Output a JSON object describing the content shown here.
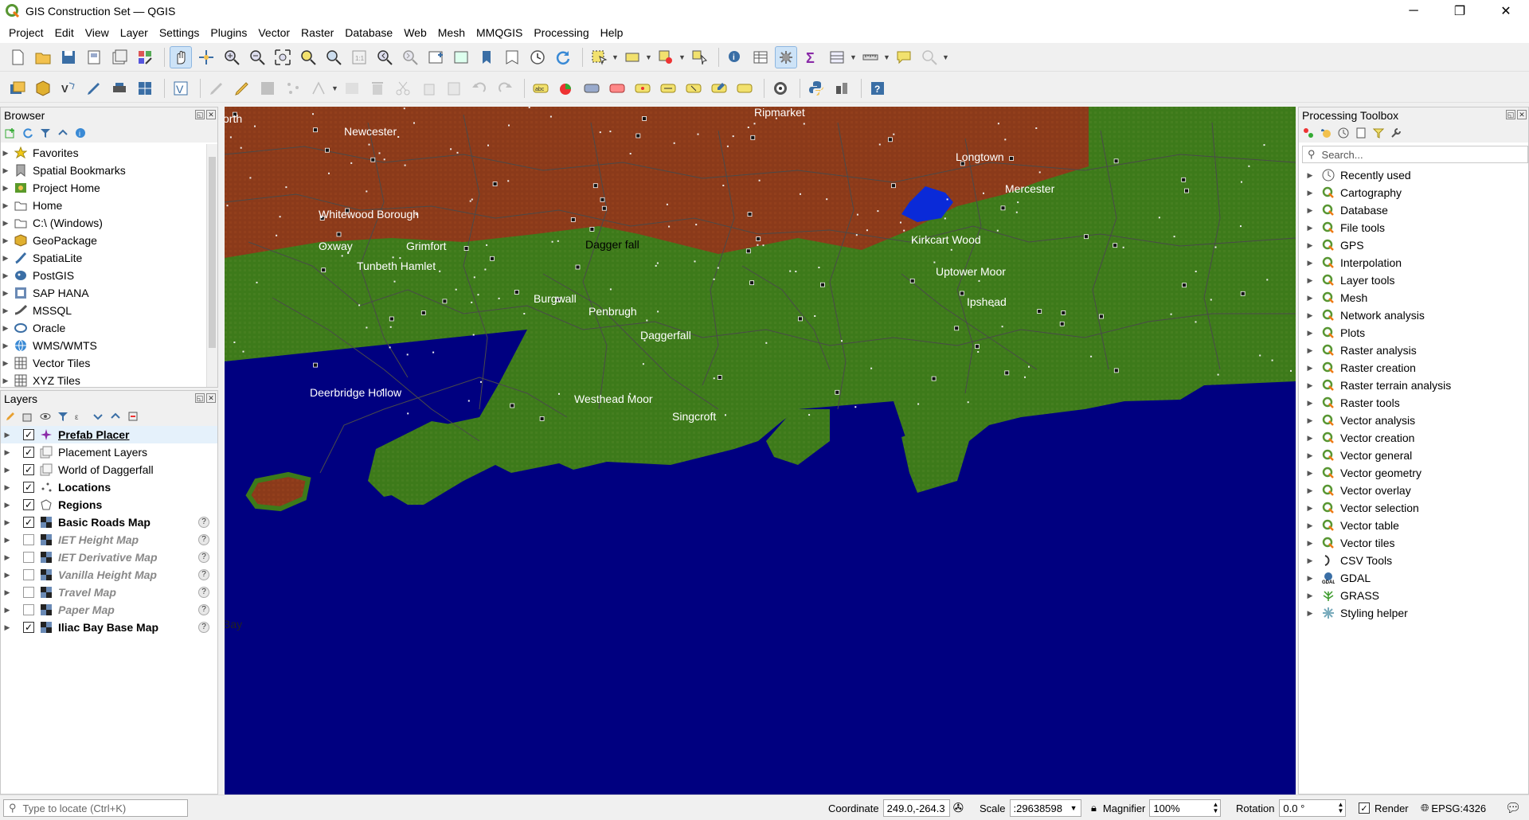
{
  "window": {
    "title": "GIS Construction Set — QGIS",
    "minimize": "─",
    "maximize": "❐",
    "close": "✕"
  },
  "menu": [
    "Project",
    "Edit",
    "View",
    "Layer",
    "Settings",
    "Plugins",
    "Vector",
    "Raster",
    "Database",
    "Web",
    "Mesh",
    "MMQGIS",
    "Processing",
    "Help"
  ],
  "browser": {
    "title": "Browser",
    "items": [
      {
        "label": "Favorites",
        "icon": "star-icon"
      },
      {
        "label": "Spatial Bookmarks",
        "icon": "bookmark-icon"
      },
      {
        "label": "Project Home",
        "icon": "project-home-icon"
      },
      {
        "label": "Home",
        "icon": "folder-icon"
      },
      {
        "label": "C:\\ (Windows)",
        "icon": "drive-icon"
      },
      {
        "label": "GeoPackage",
        "icon": "geopackage-icon"
      },
      {
        "label": "SpatiaLite",
        "icon": "spatialite-icon"
      },
      {
        "label": "PostGIS",
        "icon": "postgis-icon"
      },
      {
        "label": "SAP HANA",
        "icon": "sap-hana-icon"
      },
      {
        "label": "MSSQL",
        "icon": "mssql-icon"
      },
      {
        "label": "Oracle",
        "icon": "oracle-icon"
      },
      {
        "label": "WMS/WMTS",
        "icon": "globe-icon"
      },
      {
        "label": "Vector Tiles",
        "icon": "grid-icon"
      },
      {
        "label": "XYZ Tiles",
        "icon": "grid-icon"
      }
    ]
  },
  "layers": {
    "title": "Layers",
    "items": [
      {
        "label": "Prefab Placer",
        "checked": true,
        "style": "bold under",
        "icon": "star-sparkle-icon",
        "unknown": false
      },
      {
        "label": "Placement Layers",
        "checked": true,
        "style": "",
        "icon": "group-icon",
        "unknown": false
      },
      {
        "label": "World of Daggerfall",
        "checked": true,
        "style": "",
        "icon": "group-icon",
        "unknown": false
      },
      {
        "label": "Locations",
        "checked": true,
        "style": "bold",
        "icon": "points-icon",
        "unknown": false
      },
      {
        "label": "Regions",
        "checked": true,
        "style": "bold",
        "icon": "polygon-icon",
        "unknown": false
      },
      {
        "label": "Basic Roads Map",
        "checked": true,
        "style": "bold",
        "icon": "raster-icon",
        "unknown": true
      },
      {
        "label": "IET Height Map",
        "checked": false,
        "style": "italic",
        "icon": "raster-icon",
        "unknown": true
      },
      {
        "label": "IET Derivative Map",
        "checked": false,
        "style": "italic",
        "icon": "raster-icon",
        "unknown": true
      },
      {
        "label": "Vanilla Height Map",
        "checked": false,
        "style": "italic",
        "icon": "raster-icon",
        "unknown": true
      },
      {
        "label": "Travel Map",
        "checked": false,
        "style": "italic",
        "icon": "raster-icon",
        "unknown": true
      },
      {
        "label": "Paper Map",
        "checked": false,
        "style": "italic",
        "icon": "raster-icon",
        "unknown": true
      },
      {
        "label": "Iliac Bay Base Map",
        "checked": true,
        "style": "bold",
        "icon": "raster-icon",
        "unknown": true
      }
    ],
    "unknown_mark": "?"
  },
  "map": {
    "colors": {
      "sea": "#000080",
      "land": "#3d7a1a",
      "highland": "#8b3a1a",
      "road": "#555555",
      "lake": "#0a2ad8"
    },
    "labels": [
      {
        "text": "orth",
        "color": "#fff"
      },
      {
        "text": "Newcester",
        "color": "#fff"
      },
      {
        "text": "Ripmarket",
        "color": "#fff"
      },
      {
        "text": "Longtown",
        "color": "#fff"
      },
      {
        "text": "Mercester",
        "color": "#fff"
      },
      {
        "text": "Whitewood Borough",
        "color": "#fff"
      },
      {
        "text": "Oxway",
        "color": "#fff"
      },
      {
        "text": "Grimfort",
        "color": "#fff"
      },
      {
        "text": "Dagger fall",
        "color": "#000"
      },
      {
        "text": "Kirkcart Wood",
        "color": "#fff"
      },
      {
        "text": "Tunbeth Hamlet",
        "color": "#fff"
      },
      {
        "text": "Uptower Moor",
        "color": "#fff"
      },
      {
        "text": "Burgwall",
        "color": "#fff"
      },
      {
        "text": "Ipshead",
        "color": "#fff"
      },
      {
        "text": "Penbrugh",
        "color": "#fff"
      },
      {
        "text": "Daggerfall",
        "color": "#fff"
      },
      {
        "text": "Deerbridge Hollow",
        "color": "#fff"
      },
      {
        "text": "Westhead Moor",
        "color": "#fff"
      },
      {
        "text": "Singcroft",
        "color": "#fff"
      },
      {
        "text": "Bay",
        "color": "#222"
      }
    ]
  },
  "toolbox": {
    "title": "Processing Toolbox",
    "search_placeholder": "Search...",
    "items": [
      {
        "label": "Recently used",
        "icon": "clock-icon"
      },
      {
        "label": "Cartography",
        "icon": "qgis-icon"
      },
      {
        "label": "Database",
        "icon": "qgis-icon"
      },
      {
        "label": "File tools",
        "icon": "qgis-icon"
      },
      {
        "label": "GPS",
        "icon": "qgis-icon"
      },
      {
        "label": "Interpolation",
        "icon": "qgis-icon"
      },
      {
        "label": "Layer tools",
        "icon": "qgis-icon"
      },
      {
        "label": "Mesh",
        "icon": "qgis-icon"
      },
      {
        "label": "Network analysis",
        "icon": "qgis-icon"
      },
      {
        "label": "Plots",
        "icon": "qgis-icon"
      },
      {
        "label": "Raster analysis",
        "icon": "qgis-icon"
      },
      {
        "label": "Raster creation",
        "icon": "qgis-icon"
      },
      {
        "label": "Raster terrain analysis",
        "icon": "qgis-icon"
      },
      {
        "label": "Raster tools",
        "icon": "qgis-icon"
      },
      {
        "label": "Vector analysis",
        "icon": "qgis-icon"
      },
      {
        "label": "Vector creation",
        "icon": "qgis-icon"
      },
      {
        "label": "Vector general",
        "icon": "qgis-icon"
      },
      {
        "label": "Vector geometry",
        "icon": "qgis-icon"
      },
      {
        "label": "Vector overlay",
        "icon": "qgis-icon"
      },
      {
        "label": "Vector selection",
        "icon": "qgis-icon"
      },
      {
        "label": "Vector table",
        "icon": "qgis-icon"
      },
      {
        "label": "Vector tiles",
        "icon": "qgis-icon"
      },
      {
        "label": "CSV Tools",
        "icon": "csv-icon"
      },
      {
        "label": "GDAL",
        "icon": "gdal-icon"
      },
      {
        "label": "GRASS",
        "icon": "grass-icon"
      },
      {
        "label": "Styling helper",
        "icon": "gear-icon"
      }
    ]
  },
  "status": {
    "locate_placeholder": "Type to locate (Ctrl+K)",
    "coordinate_label": "Coordinate",
    "coordinate_value": "249.0,-264.3",
    "scale_label": "Scale",
    "scale_value": ":29638598",
    "magnifier_label": "Magnifier",
    "magnifier_value": "100%",
    "rotation_label": "Rotation",
    "rotation_value": "0.0 °",
    "render_label": "Render",
    "render_checked": true,
    "crs": "EPSG:4326"
  }
}
